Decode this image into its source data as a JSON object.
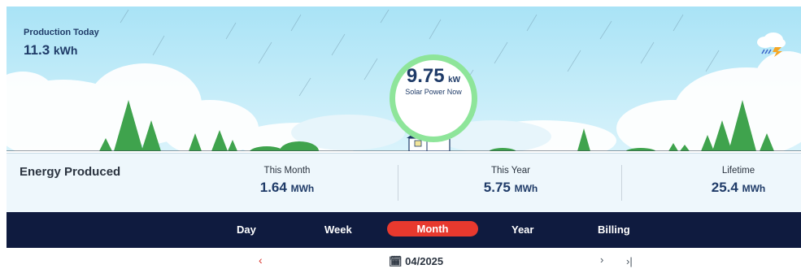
{
  "production_today": {
    "label": "Production Today",
    "value": "11.3",
    "unit": "kWh"
  },
  "solar_now": {
    "value": "9.75",
    "unit": "kW",
    "label": "Solar Power Now"
  },
  "stats": {
    "title": "Energy Produced",
    "this_month": {
      "label": "This Month",
      "value": "1.64",
      "unit": "MWh"
    },
    "this_year": {
      "label": "This Year",
      "value": "5.75",
      "unit": "MWh"
    },
    "lifetime": {
      "label": "Lifetime",
      "value": "25.4",
      "unit": "MWh"
    }
  },
  "tabs": [
    {
      "label": "Day"
    },
    {
      "label": "Week"
    },
    {
      "label": "Month",
      "active": true
    },
    {
      "label": "Year"
    },
    {
      "label": "Billing"
    }
  ],
  "pager": {
    "prev": "‹",
    "date": "04/2025",
    "next": "›",
    "last": "›|"
  },
  "colors": {
    "sky": "#bfeaf8",
    "tabs_bg": "#0f1b3f",
    "active_tab": "#e8392e",
    "stats_bg": "#eef7fc",
    "tree": "#3fa34d",
    "bubble_ring": "#8ee59a"
  },
  "icons": {
    "weather": "cloud-rain-lightning-icon",
    "calendar": "calendar-icon"
  }
}
